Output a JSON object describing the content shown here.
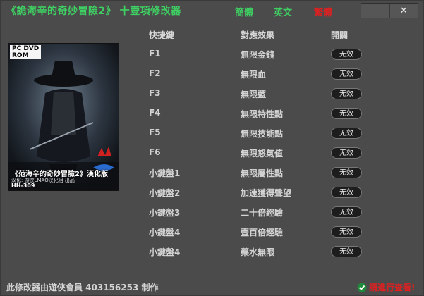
{
  "window": {
    "title": "《詭海辛的奇妙冒險2》 十壹項修改器",
    "lang_traditional": "簡體",
    "lang_english": "英文",
    "lang_japanese": "繁體",
    "minimize_glyph": "—",
    "close_glyph": "✕"
  },
  "cover": {
    "badge_line1": "PC DVD",
    "badge_line2": "ROM",
    "game_name": "《范海辛的奇妙冒險2》漢化版",
    "subtitle": "汉化: 游侠LMAO汉化组 出品",
    "code": "HH-309"
  },
  "headers": {
    "hotkey": "快捷鍵",
    "effect": "對應效果",
    "toggle": "開關"
  },
  "cheats": [
    {
      "key": "F1",
      "effect": "無限金錢",
      "state": "无效"
    },
    {
      "key": "F2",
      "effect": "無限血",
      "state": "无效"
    },
    {
      "key": "F3",
      "effect": "無限藍",
      "state": "无效"
    },
    {
      "key": "F4",
      "effect": "無限特性點",
      "state": "无效"
    },
    {
      "key": "F5",
      "effect": "無限技能點",
      "state": "无效"
    },
    {
      "key": "F6",
      "effect": "無限怒氣值",
      "state": "无效"
    },
    {
      "key": "小鍵盤1",
      "effect": "無限屬性點",
      "state": "无效"
    },
    {
      "key": "小鍵盤2",
      "effect": "加速獲得聲望",
      "state": "无效"
    },
    {
      "key": "小鍵盤3",
      "effect": "二十倍經驗",
      "state": "无效"
    },
    {
      "key": "小鍵盤4",
      "effect": "壹百倍經驗",
      "state": "无效"
    },
    {
      "key": "小鍵盤4",
      "effect": "藥水無限",
      "state": "无效"
    }
  ],
  "footer": {
    "credit": "此修改器由遊俠會員 403156253 制作",
    "link": "請進行查看!"
  },
  "colors": {
    "accent_green": "#3fd063",
    "alert_red": "#e02020",
    "background": "#4b4b4b"
  }
}
